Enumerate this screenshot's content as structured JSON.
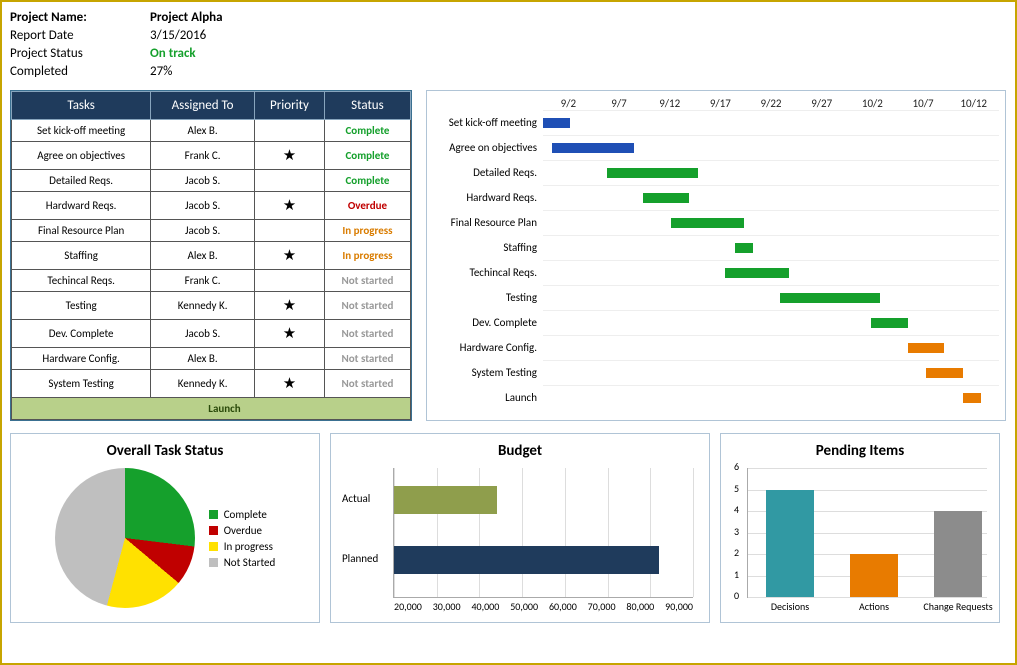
{
  "meta": {
    "labels": {
      "project": "Project Name:",
      "date": "Report Date",
      "status": "Project Status",
      "completed": "Completed"
    },
    "project": "Project Alpha",
    "date": "3/15/2016",
    "status": "On track",
    "completed": "27%"
  },
  "tasksTable": {
    "headers": [
      "Tasks",
      "Assigned To",
      "Priority",
      "Status"
    ],
    "rows": [
      {
        "task": "Set kick-off meeting",
        "assigned": "Alex B.",
        "priority": false,
        "status": "Complete",
        "statusClass": "green"
      },
      {
        "task": "Agree on objectives",
        "assigned": "Frank C.",
        "priority": true,
        "status": "Complete",
        "statusClass": "green"
      },
      {
        "task": "Detailed Reqs.",
        "assigned": "Jacob S.",
        "priority": false,
        "status": "Complete",
        "statusClass": "green"
      },
      {
        "task": "Hardward Reqs.",
        "assigned": "Jacob S.",
        "priority": true,
        "status": "Overdue",
        "statusClass": "red"
      },
      {
        "task": "Final Resource Plan",
        "assigned": "Jacob S.",
        "priority": false,
        "status": "In progress",
        "statusClass": "orange"
      },
      {
        "task": "Staffing",
        "assigned": "Alex B.",
        "priority": true,
        "status": "In progress",
        "statusClass": "orange"
      },
      {
        "task": "Techincal Reqs.",
        "assigned": "Frank C.",
        "priority": false,
        "status": "Not started",
        "statusClass": "grey"
      },
      {
        "task": "Testing",
        "assigned": "Kennedy K.",
        "priority": true,
        "status": "Not started",
        "statusClass": "grey"
      },
      {
        "task": "Dev. Complete",
        "assigned": "Jacob S.",
        "priority": true,
        "status": "Not started",
        "statusClass": "grey"
      },
      {
        "task": "Hardware Config.",
        "assigned": "Alex B.",
        "priority": false,
        "status": "Not started",
        "statusClass": "grey"
      },
      {
        "task": "System Testing",
        "assigned": "Kennedy K.",
        "priority": true,
        "status": "Not started",
        "statusClass": "grey"
      }
    ],
    "launch": "Launch"
  },
  "chart_data": [
    {
      "type": "bar",
      "name": "gantt",
      "x_ticks": [
        "9/2",
        "9/7",
        "9/12",
        "9/17",
        "9/22",
        "9/27",
        "10/2",
        "10/7",
        "10/12"
      ],
      "tasks": [
        {
          "label": "Set kick-off meeting",
          "start": 0,
          "width": 6,
          "color": "bar-blue"
        },
        {
          "label": "Agree on objectives",
          "start": 2,
          "width": 18,
          "color": "bar-blue"
        },
        {
          "label": "Detailed Reqs.",
          "start": 14,
          "width": 20,
          "color": "bar-green"
        },
        {
          "label": "Hardward Reqs.",
          "start": 22,
          "width": 10,
          "color": "bar-green"
        },
        {
          "label": "Final Resource Plan",
          "start": 28,
          "width": 16,
          "color": "bar-green"
        },
        {
          "label": "Staffing",
          "start": 42,
          "width": 4,
          "color": "bar-green"
        },
        {
          "label": "Techincal Reqs.",
          "start": 40,
          "width": 14,
          "color": "bar-green"
        },
        {
          "label": "Testing",
          "start": 52,
          "width": 22,
          "color": "bar-green"
        },
        {
          "label": "Dev. Complete",
          "start": 72,
          "width": 8,
          "color": "bar-green"
        },
        {
          "label": "Hardware Config.",
          "start": 80,
          "width": 8,
          "color": "bar-orange"
        },
        {
          "label": "System Testing",
          "start": 84,
          "width": 8,
          "color": "bar-orange"
        },
        {
          "label": "Launch",
          "start": 92,
          "width": 4,
          "color": "bar-orange"
        }
      ]
    },
    {
      "type": "pie",
      "name": "overall_task_status",
      "title": "Overall Task Status",
      "series": [
        {
          "name": "Complete",
          "value": 27,
          "color": "#15a02c"
        },
        {
          "name": "Overdue",
          "value": 9,
          "color": "#c00000"
        },
        {
          "name": "In progress",
          "value": 18,
          "color": "#ffe100"
        },
        {
          "name": "Not Started",
          "value": 46,
          "color": "#bfbfbf"
        }
      ]
    },
    {
      "type": "bar",
      "name": "budget",
      "title": "Budget",
      "orientation": "horizontal",
      "x_ticks": [
        20000,
        30000,
        40000,
        50000,
        60000,
        70000,
        80000,
        90000
      ],
      "x_tick_labels": [
        "20,000",
        "30,000",
        "40,000",
        "50,000",
        "60,000",
        "70,000",
        "80,000",
        "90,000"
      ],
      "series": [
        {
          "name": "Actual",
          "value": 44000,
          "color": "#8f9e4c"
        },
        {
          "name": "Planned",
          "value": 82000,
          "color": "#1f3b5c"
        }
      ],
      "xlim": [
        20000,
        90000
      ]
    },
    {
      "type": "bar",
      "name": "pending_items",
      "title": "Pending Items",
      "categories": [
        "Decisions",
        "Actions",
        "Change Requests"
      ],
      "values": [
        5,
        2,
        4
      ],
      "colors": [
        "#3199a3",
        "#e87b00",
        "#8c8c8c"
      ],
      "ylim": [
        0,
        6
      ],
      "y_ticks": [
        0,
        1,
        2,
        3,
        4,
        5,
        6
      ]
    }
  ]
}
